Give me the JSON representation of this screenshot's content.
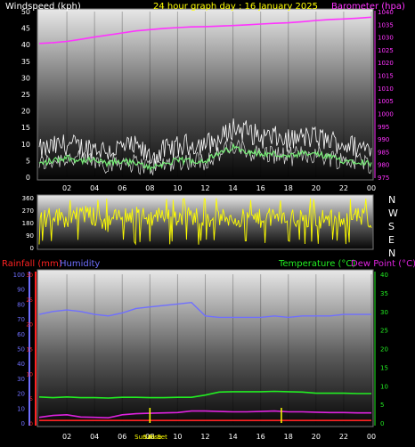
{
  "header": {
    "windspeed_label": "Windspeed (kph)",
    "title": "24 hour graph day : 16 January 2025",
    "barometer_label": "Barometer (hpa)"
  },
  "colors": {
    "background": "#000000",
    "windspeed": "#ffffff",
    "gust": "#ffffff",
    "avg_wind": "#77ee77",
    "barometer": "#ff33ff",
    "direction": "#ffff00",
    "rainfall": "#ff2222",
    "humidity": "#6f6fff",
    "temperature": "#22ee22",
    "dewpoint": "#dd22dd",
    "sun": "#ffff00"
  },
  "chart_data": [
    {
      "type": "line",
      "name": "wind-baro",
      "x_ticks": [
        "02",
        "04",
        "06",
        "08",
        "10",
        "12",
        "14",
        "16",
        "18",
        "20",
        "22",
        "00"
      ],
      "left_axis": {
        "label": "Windspeed (kph)",
        "ticks": [
          0,
          5,
          10,
          15,
          20,
          25,
          30,
          35,
          40,
          45,
          50
        ],
        "ylim": [
          0,
          50
        ]
      },
      "right_axis": {
        "label": "Barometer (hpa)",
        "ticks": [
          975,
          980,
          985,
          990,
          995,
          1000,
          1005,
          1010,
          1015,
          1020,
          1025,
          1030,
          1035,
          1040
        ],
        "ylim": [
          975,
          1040
        ]
      },
      "series": [
        {
          "name": "Barometer",
          "axis": "right",
          "x": [
            0,
            1,
            2,
            3,
            4,
            5,
            6,
            7,
            8,
            9,
            10,
            11,
            12,
            13,
            14,
            15,
            16,
            17,
            18,
            19,
            20,
            21,
            22,
            23,
            24
          ],
          "values": [
            1027.5,
            1027.8,
            1028.3,
            1029.1,
            1030.0,
            1030.8,
            1031.6,
            1032.4,
            1032.9,
            1033.4,
            1033.7,
            1034.0,
            1034.1,
            1034.3,
            1034.5,
            1034.8,
            1035.1,
            1035.4,
            1035.6,
            1036.0,
            1036.5,
            1036.9,
            1037.1,
            1037.4,
            1037.8
          ]
        },
        {
          "name": "Wind speed",
          "axis": "left",
          "x": [
            0,
            1,
            2,
            3,
            4,
            5,
            6,
            7,
            8,
            9,
            10,
            11,
            12,
            13,
            14,
            15,
            16,
            17,
            18,
            19,
            20,
            21,
            22,
            23,
            24
          ],
          "values": [
            4,
            5,
            6,
            5,
            5,
            4,
            5,
            4,
            3,
            4,
            5,
            5,
            5,
            7,
            9,
            8,
            7,
            7,
            6,
            7,
            7,
            6,
            5,
            5,
            4
          ]
        },
        {
          "name": "Wind gust",
          "axis": "left",
          "x": [
            0,
            1,
            2,
            3,
            4,
            5,
            6,
            7,
            8,
            9,
            10,
            11,
            12,
            13,
            14,
            15,
            16,
            17,
            18,
            19,
            20,
            21,
            22,
            23,
            24
          ],
          "values": [
            8,
            9,
            10,
            9,
            9,
            8,
            9,
            9,
            6,
            8,
            9,
            10,
            10,
            11,
            15,
            14,
            12,
            12,
            11,
            12,
            12,
            11,
            10,
            9,
            9
          ]
        }
      ]
    },
    {
      "type": "line",
      "name": "wind-direction",
      "x_ticks": [
        "02",
        "04",
        "06",
        "08",
        "10",
        "12",
        "14",
        "16",
        "18",
        "20",
        "22",
        "00"
      ],
      "left_axis": {
        "ticks": [
          0,
          90,
          180,
          270,
          360
        ],
        "ylim": [
          0,
          360
        ]
      },
      "right_labels": [
        "N",
        "W",
        "S",
        "E",
        "N"
      ],
      "series": [
        {
          "name": "Wind direction",
          "x": [
            0,
            1,
            2,
            3,
            4,
            5,
            6,
            7,
            8,
            9,
            10,
            11,
            12,
            13,
            14,
            15,
            16,
            17,
            18,
            19,
            20,
            21,
            22,
            23,
            24
          ],
          "values": [
            200,
            230,
            210,
            250,
            220,
            180,
            240,
            230,
            210,
            250,
            220,
            230,
            220,
            210,
            215,
            205,
            210,
            220,
            215,
            200,
            205,
            210,
            215,
            220,
            210
          ]
        }
      ]
    },
    {
      "type": "line",
      "name": "rain-humidity-temp",
      "x_ticks": [
        "02",
        "04",
        "06",
        "08",
        "10",
        "12",
        "14",
        "16",
        "18",
        "20",
        "22",
        "00"
      ],
      "legend": [
        "Rainfall (mm)",
        "Humidity",
        "Temperature (°C)",
        "Dew Point (°C)"
      ],
      "humidity_axis": {
        "ticks": [
          0,
          10,
          20,
          30,
          40,
          50,
          60,
          70,
          80,
          90,
          100
        ],
        "ylim": [
          0,
          100
        ]
      },
      "rain_axis": {
        "ticks": [
          0,
          5,
          10,
          15,
          20,
          25,
          30
        ],
        "ylim": [
          0,
          30
        ]
      },
      "temp_axis": {
        "ticks": [
          0,
          5,
          10,
          15,
          20,
          25,
          30,
          35,
          40
        ],
        "ylim": [
          0,
          40
        ]
      },
      "series": [
        {
          "name": "Humidity",
          "axis": "humidity",
          "x": [
            0,
            1,
            2,
            3,
            4,
            5,
            6,
            7,
            8,
            9,
            10,
            11,
            12,
            13,
            14,
            15,
            16,
            17,
            18,
            19,
            20,
            21,
            22,
            23,
            24
          ],
          "values": [
            73,
            75,
            76,
            75,
            73,
            72,
            74,
            77,
            78,
            79,
            80,
            81,
            72,
            71,
            71,
            71,
            71,
            72,
            71,
            72,
            72,
            72,
            73,
            73,
            73
          ]
        },
        {
          "name": "Temperature",
          "axis": "temp",
          "x": [
            0,
            1,
            2,
            3,
            4,
            5,
            6,
            7,
            8,
            9,
            10,
            11,
            12,
            13,
            14,
            15,
            16,
            17,
            18,
            19,
            20,
            21,
            22,
            23,
            24
          ],
          "values": [
            7.0,
            6.8,
            7.0,
            6.8,
            6.8,
            6.7,
            6.9,
            6.9,
            6.8,
            6.8,
            6.9,
            6.9,
            7.5,
            8.3,
            8.4,
            8.4,
            8.4,
            8.5,
            8.4,
            8.3,
            8.0,
            8.0,
            8.0,
            7.9,
            7.9
          ]
        },
        {
          "name": "Dew Point",
          "axis": "temp",
          "x": [
            0,
            1,
            2,
            3,
            4,
            5,
            6,
            7,
            8,
            9,
            10,
            11,
            12,
            13,
            14,
            15,
            16,
            17,
            18,
            19,
            20,
            21,
            22,
            23,
            24
          ],
          "values": [
            1.5,
            2.0,
            2.2,
            1.6,
            1.5,
            1.4,
            2.2,
            2.5,
            2.6,
            2.7,
            2.8,
            3.2,
            3.2,
            3.1,
            3.0,
            3.0,
            3.1,
            3.2,
            3.0,
            3.0,
            2.9,
            2.8,
            2.8,
            2.7,
            2.7
          ]
        },
        {
          "name": "Rainfall",
          "axis": "rain",
          "x": [
            0,
            24
          ],
          "values": [
            0.5,
            0.5
          ]
        }
      ],
      "sunrise_label": "Sun Rise",
      "sunset_label": "Sun Set",
      "sunrise_hour": 8.0,
      "sunset_hour": 17.5
    }
  ]
}
